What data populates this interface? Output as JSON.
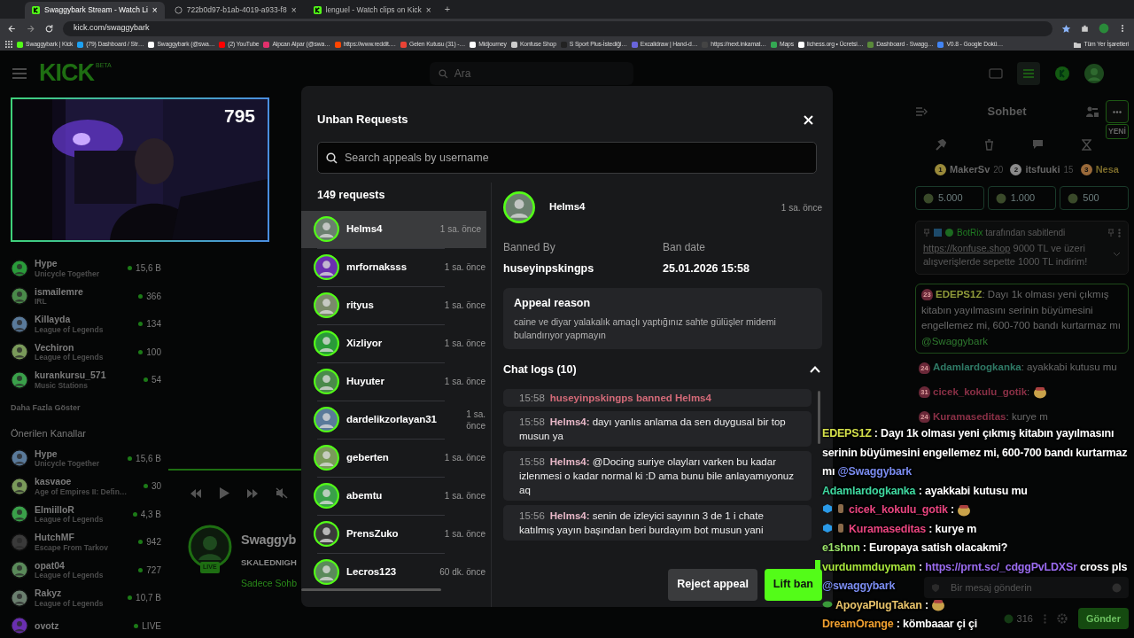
{
  "browser": {
    "tabs": [
      {
        "title": "Swaggybark Stream - Watch Li",
        "close": "×",
        "selected": true
      },
      {
        "title": "722b0d97-b1ab-4019-a933-f8",
        "close": "×",
        "selected": false
      },
      {
        "title": "lenguel - Watch clips on Kick",
        "close": "×",
        "selected": false
      }
    ],
    "new_tab": "+",
    "url": "kick.com/swaggybark",
    "bookmarks": [
      "Swaggybark | Kick",
      "(79) Dashboard / Str…",
      "Swaggybark (@swa…",
      "(2) YouTube",
      "Alpcan Alpar (@swa…",
      "https://www.reddit.…",
      "Gelen Kutusu (31) -…",
      "Midjourney",
      "Konfuse Shop",
      "S Sport Plus-İstediği…",
      "Excalidraw | Hand-d…",
      "https://next.inkamat…",
      "Maps",
      "lichess.org • Ücretsi…",
      "Dashboard - Swagg…",
      "V0.8 - Google Dokü…"
    ],
    "all_bookmarks": "Tüm Yer İşaretleri"
  },
  "header": {
    "logo": "KICK",
    "logo_badge": "BETA",
    "search": {
      "placeholder": "Ara"
    }
  },
  "webcam": {
    "viewer_count": "795"
  },
  "sidebar": {
    "followed": [
      {
        "name": "Hype",
        "category": "Unicycle Together",
        "viewers": "15,6 B"
      },
      {
        "name": "ismailemre",
        "category": "IRL",
        "viewers": "366"
      },
      {
        "name": "Killayda",
        "category": "League of Legends",
        "viewers": "134"
      },
      {
        "name": "Vechiron",
        "category": "League of Legends",
        "viewers": "100"
      },
      {
        "name": "kurankursu_571",
        "category": "Music Stations",
        "viewers": "54"
      }
    ],
    "show_more": "Daha Fazla Göster",
    "recommended_title": "Önerilen Kanallar",
    "recommended": [
      {
        "name": "Hype",
        "category": "Unicycle Together",
        "viewers": "15,6 B"
      },
      {
        "name": "kasvaoe",
        "category": "Age of Empires II: Defin…",
        "viewers": "30"
      },
      {
        "name": "ElmiilloR",
        "category": "League of Legends",
        "viewers": "4,3 B"
      },
      {
        "name": "HutchMF",
        "category": "Escape From Tarkov",
        "viewers": "942"
      },
      {
        "name": "opat04",
        "category": "League of Legends",
        "viewers": "727"
      },
      {
        "name": "Rakyz",
        "category": "League of Legends",
        "viewers": "10,7 B"
      },
      {
        "name": "ovotz",
        "viewers": "LIVE"
      }
    ]
  },
  "channel": {
    "name": "Swaggyb",
    "title": "SKALEDNIGH",
    "category": "Sadece Sohb",
    "live_badge": "LIVE"
  },
  "chat": {
    "title": "Sohbet",
    "new_badge": "YENİ",
    "leaderboard": [
      {
        "rank": "1",
        "name": "MakerSv",
        "count": "20"
      },
      {
        "rank": "2",
        "name": "itsfuuki",
        "count": "15"
      },
      {
        "rank": "3",
        "name": "Nesa"
      }
    ],
    "gift_goals": [
      "5.000",
      "1.000",
      "500"
    ],
    "pinned": {
      "user": "BotRix",
      "by": "tarafından sabitlendi",
      "link": "https://konfuse.shop",
      "text": "9000 TL ve üzeri alışverişlerde sepette 1000 TL indirim!"
    },
    "messages": [
      {
        "badge": "23",
        "user": "EDEPS1Z",
        "sep": ":",
        "color": "#8f9a3a",
        "boxed": true,
        "parts": [
          {
            "kind": "text",
            "text": "Dayı 1k olması yeni çıkmış kitabın yayılmasını serinin büyümesini engellemez mi, 600-700 bandı kurtarmaz mı"
          },
          {
            "kind": "mention",
            "text": "@Swaggybark"
          }
        ]
      },
      {
        "badge": "24",
        "user": "Adamlardogkanka",
        "sep": ":",
        "color": "#2f7a66",
        "boxed": false,
        "parts": [
          {
            "kind": "text",
            "text": "ayakkabi kutusu mu"
          }
        ]
      },
      {
        "badge": "31",
        "user": "cicek_kokulu_gotik",
        "sep": ":",
        "color": "#8a3046",
        "boxed": false,
        "parts": [
          {
            "kind": "emote"
          }
        ]
      },
      {
        "badge": "24",
        "user": "Kuramaseditas",
        "sep": ":",
        "color": "#8a3046",
        "boxed": false,
        "parts": [
          {
            "kind": "text",
            "text": "kurye m"
          }
        ]
      }
    ],
    "input": {
      "placeholder": "Bir mesaj gönderin"
    },
    "points": "316",
    "send": "Gönder"
  },
  "overlay_chat": [
    {
      "user": "EDEPS1Z",
      "sep": ":",
      "color": "#d4e04a",
      "highlighted": false,
      "parts": [
        {
          "kind": "text",
          "text": "Dayı 1k olması yeni çıkmış kitabın yayılmasını serinin büyümesini engellemez mi, 600-700 bandı kurtarmaz mı"
        },
        {
          "kind": "mention",
          "text": "@Swaggybark"
        }
      ]
    },
    {
      "user": "Adamlardogkanka",
      "sep": ":",
      "color": "#3fd9a0",
      "highlighted": false,
      "parts": [
        {
          "kind": "text",
          "text": "ayakkabi kutusu mu"
        }
      ]
    },
    {
      "user": "cicek_kokulu_gotik",
      "sep": ":",
      "color": "#e8457f",
      "highlighted": false,
      "badges": [
        {
          "kind": "cube"
        },
        {
          "kind": "figure"
        }
      ],
      "parts": [
        {
          "kind": "emote"
        }
      ]
    },
    {
      "user": "Kuramaseditas",
      "sep": ":",
      "color": "#e8457f",
      "highlighted": false,
      "badges": [
        {
          "kind": "cube"
        },
        {
          "kind": "figure"
        }
      ],
      "parts": [
        {
          "kind": "text",
          "text": "kurye m"
        }
      ]
    },
    {
      "user": "e1shnn",
      "sep": ":",
      "color": "#9be36a",
      "highlighted": false,
      "parts": [
        {
          "kind": "text",
          "text": "Europaya satish olacakmi?"
        }
      ]
    },
    {
      "user": "vurdummduymam",
      "sep": ":",
      "color": "#a8e63c",
      "highlighted": true,
      "parts": [
        {
          "kind": "link",
          "text": "https://prnt.sc/_cdggPvLDXSr"
        },
        {
          "kind": "text",
          "text": "cross pls"
        },
        {
          "kind": "mention",
          "text": "@swaggybark"
        }
      ]
    },
    {
      "user": "ApoyaPlugTakan",
      "sep": ":",
      "color": "#e8c36a",
      "highlighted": false,
      "badges": [
        {
          "kind": "leaf"
        }
      ],
      "parts": [
        {
          "kind": "emote"
        }
      ]
    },
    {
      "user": "DreamOrange",
      "sep": ":",
      "color": "#f0a030",
      "highlighted": false,
      "parts": [
        {
          "kind": "text",
          "text": "kömbaaar çi çi"
        }
      ]
    }
  ],
  "modal": {
    "title": "Unban Requests",
    "search": {
      "placeholder": "Search appeals by username"
    },
    "count": "149 requests",
    "requests": [
      {
        "name": "Helms4",
        "time": "1 sa. önce",
        "selected": true
      },
      {
        "name": "mrfornaksss",
        "time": "1 sa. önce",
        "selected": false
      },
      {
        "name": "rityus",
        "time": "1 sa. önce",
        "selected": false
      },
      {
        "name": "Xizliyor",
        "time": "1 sa. önce",
        "selected": false
      },
      {
        "name": "Huyuter",
        "time": "1 sa. önce",
        "selected": false
      },
      {
        "name": "dardelikzorlayan31",
        "time": "1 sa. önce",
        "selected": false
      },
      {
        "name": "geberten",
        "time": "1 sa. önce",
        "selected": false
      },
      {
        "name": "abemtu",
        "time": "1 sa. önce",
        "selected": false
      },
      {
        "name": "PrensZuko",
        "time": "1 sa. önce",
        "selected": false
      },
      {
        "name": "Lecros123",
        "time": "60 dk. önce",
        "selected": false
      }
    ],
    "detail": {
      "name": "Helms4",
      "time": "1 sa. önce",
      "banned_by_label": "Banned By",
      "banned_by": "huseyinpskingps",
      "ban_date_label": "Ban date",
      "ban_date": "25.01.2026 15:58",
      "appeal_title": "Appeal reason",
      "appeal_text": "caine ve diyar yalakalık amaçlı yaptığınız sahte gülüşler midemi bulandırıyor yapmayın",
      "logs_title": "Chat logs (10)",
      "logs_expanded": true,
      "logs": [
        {
          "kind": "system",
          "time": "15:58",
          "text": "huseyinpskingps banned Helms4"
        },
        {
          "kind": "message",
          "time": "15:58",
          "user": "Helms4:",
          "text": "dayı yanlıs anlama da sen duygusal bir top musun ya"
        },
        {
          "kind": "message",
          "time": "15:58",
          "user": "Helms4:",
          "text": "@Docing suriye olayları varken bu kadar izlenmesi o kadar normal ki :D ama bunu bile anlayamıyonuz aq"
        },
        {
          "kind": "message",
          "time": "15:56",
          "user": "Helms4:",
          "text": "senin de izleyici sayının 3 de 1 i chate katılmış yayın başından beri burdayım bot musun yani"
        }
      ]
    },
    "buttons": [
      {
        "label": "Reject appeal",
        "kind": "secondary"
      },
      {
        "label": "Lift ban",
        "kind": "primary"
      }
    ]
  }
}
